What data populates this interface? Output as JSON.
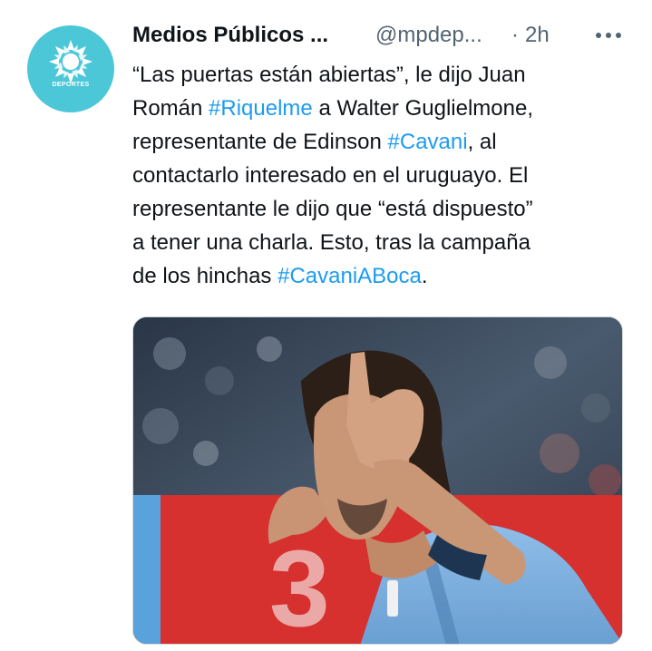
{
  "account": {
    "display_name": "Medios Públicos ...",
    "handle": "@mpdep...",
    "separator": "·",
    "time": "2h",
    "avatar_text": "DEPORTES",
    "avatar_icon": "sun-logo-icon"
  },
  "more_icon": "more-dots-icon",
  "tweet": {
    "lines": [
      [
        {
          "text": "“Las puertas están abiertas”, le dijo Juan",
          "hashtag": false
        }
      ],
      [
        {
          "text": "Román ",
          "hashtag": false
        },
        {
          "text": "#Riquelme",
          "hashtag": true
        },
        {
          "text": " a Walter Guglielmone,",
          "hashtag": false
        }
      ],
      [
        {
          "text": "representante de Edinson ",
          "hashtag": false
        },
        {
          "text": "#Cavani",
          "hashtag": true
        },
        {
          "text": ", al",
          "hashtag": false
        }
      ],
      [
        {
          "text": "contactarlo interesado en el uruguayo. El",
          "hashtag": false
        }
      ],
      [
        {
          "text": "representante le dijo que “está dispuesto”",
          "hashtag": false
        }
      ],
      [
        {
          "text": "a tener una charla. Esto, tras la campaña",
          "hashtag": false
        }
      ],
      [
        {
          "text": "de los hinchas ",
          "hashtag": false
        },
        {
          "text": "#CavaniABoca",
          "hashtag": true
        },
        {
          "text": ".",
          "hashtag": false
        }
      ]
    ]
  },
  "colors": {
    "text": "#0f1419",
    "secondary": "#536471",
    "link": "#1d9bf0",
    "avatar_bg": "#4cc7d8",
    "jersey": "#7fb0e0"
  },
  "media": {
    "kind": "photo",
    "subject": "player-photo"
  }
}
